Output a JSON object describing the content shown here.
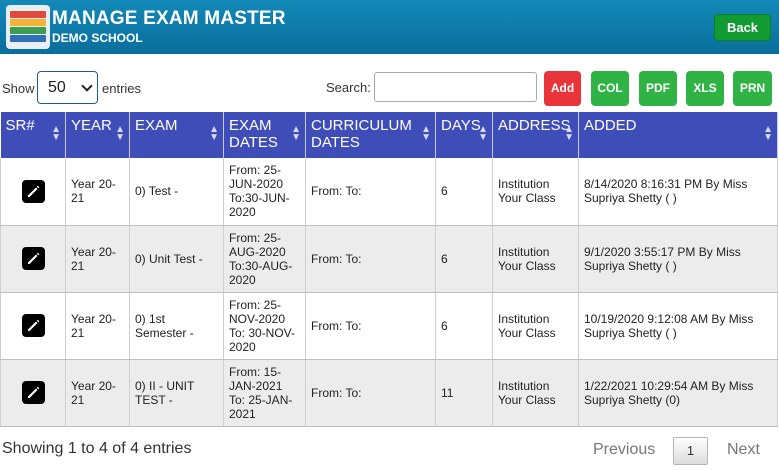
{
  "header": {
    "title": "MANAGE EXAM MASTER",
    "school": "DEMO SCHOOL",
    "back_label": "Back"
  },
  "controls": {
    "show_label": "Show",
    "entries_value": "50",
    "entries_label": "entries",
    "search_label": "Search:",
    "search_value": "",
    "buttons": {
      "add": "Add",
      "col": "COL",
      "pdf": "PDF",
      "xls": "XLS",
      "prn": "PRN"
    }
  },
  "table": {
    "columns": [
      "SR#",
      "YEAR",
      "EXAM",
      "EXAM DATES",
      "CURRICULUM DATES",
      "DAYS",
      "ADDRESS",
      "ADDED"
    ],
    "rows": [
      {
        "year": "Year 20-21",
        "exam": "0) Test -",
        "exam_dates": "From: 25-JUN-2020 To:30-JUN-2020",
        "curriculum_dates": "From: To:",
        "days": "6",
        "address": "Institution Your Class",
        "added": "8/14/2020 8:16:31 PM By Miss Supriya Shetty ( )"
      },
      {
        "year": "Year 20-21",
        "exam": "0) Unit Test -",
        "exam_dates": "From: 25-AUG-2020 To:30-AUG-2020",
        "curriculum_dates": "From: To:",
        "days": "6",
        "address": "Institution Your Class",
        "added": "9/1/2020 3:55:17 PM By Miss Supriya Shetty ( )"
      },
      {
        "year": "Year 20-21",
        "exam": "0) 1st Semester -",
        "exam_dates": "From: 25-NOV-2020 To: 30-NOV-2020",
        "curriculum_dates": "From: To:",
        "days": "6",
        "address": "Institution Your Class",
        "added": "10/19/2020 9:12:08 AM By Miss Supriya Shetty ( )"
      },
      {
        "year": "Year 20-21",
        "exam": "0) II - UNIT TEST -",
        "exam_dates": "From: 15-JAN-2021 To: 25-JAN-2021",
        "curriculum_dates": "From: To:",
        "days": "11",
        "address": "Institution Your Class",
        "added": "1/22/2021 10:29:54 AM By Miss Supriya Shetty (0)"
      }
    ]
  },
  "footer": {
    "info": "Showing 1 to 4 of 4 entries",
    "previous": "Previous",
    "page": "1",
    "next": "Next"
  },
  "icons": {
    "row_action": "edit-pencil-icon",
    "sort": "sort-arrows-icon"
  },
  "colors": {
    "header_bg": "#0a6e9c",
    "table_header_bg": "#3e4db8",
    "add_button": "#e8343a",
    "export_buttons": "#2fb344",
    "back_button": "#119b32"
  }
}
